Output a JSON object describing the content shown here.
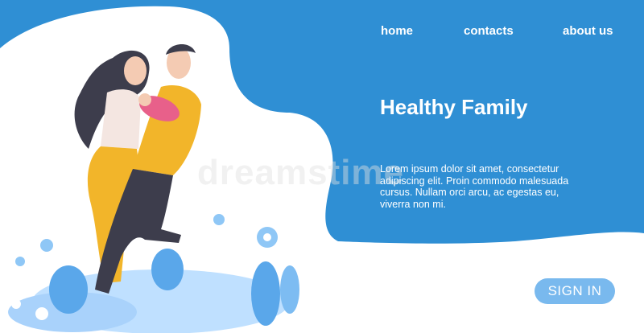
{
  "colors": {
    "brand_blue": "#2f8fd4",
    "light_blue": "#79b9ee",
    "white": "#ffffff",
    "yellow": "#f2b52a",
    "pink": "#e8608a",
    "dark": "#3d3d4c"
  },
  "nav": {
    "home": "home",
    "contacts": "contacts",
    "about": "about us"
  },
  "hero": {
    "title": "Healthy Family",
    "description": "Lorem ipsum dolor sit amet, consectetur adipiscing elit. Proin commodo malesuada cursus. Nullam orci arcu, ac egestas eu, viverra non mi."
  },
  "cta": {
    "signin_label": "SIGN IN"
  },
  "watermark": "dreamstime"
}
